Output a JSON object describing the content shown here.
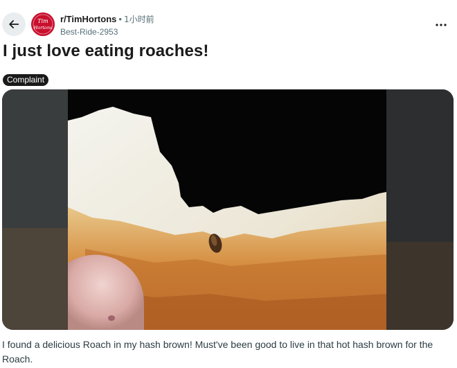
{
  "header": {
    "subreddit": "r/TimHortons",
    "separator": "•",
    "time_ago": "1小时前",
    "username": "Best-Ride-2953",
    "avatar_text_line1": "Tim",
    "avatar_text_line2": "Hortons"
  },
  "post": {
    "title": "I just love eating roaches!",
    "flair": "Complaint",
    "body": "I found a delicious Roach in my hash brown! Must've been good to live in that hot hash brown for the Roach."
  },
  "icons": {
    "back": "back-arrow-icon",
    "more": "more-options-icon"
  },
  "colors": {
    "brand": "#c8102e",
    "flair_bg": "#1a1a1b",
    "muted": "#576f76"
  }
}
